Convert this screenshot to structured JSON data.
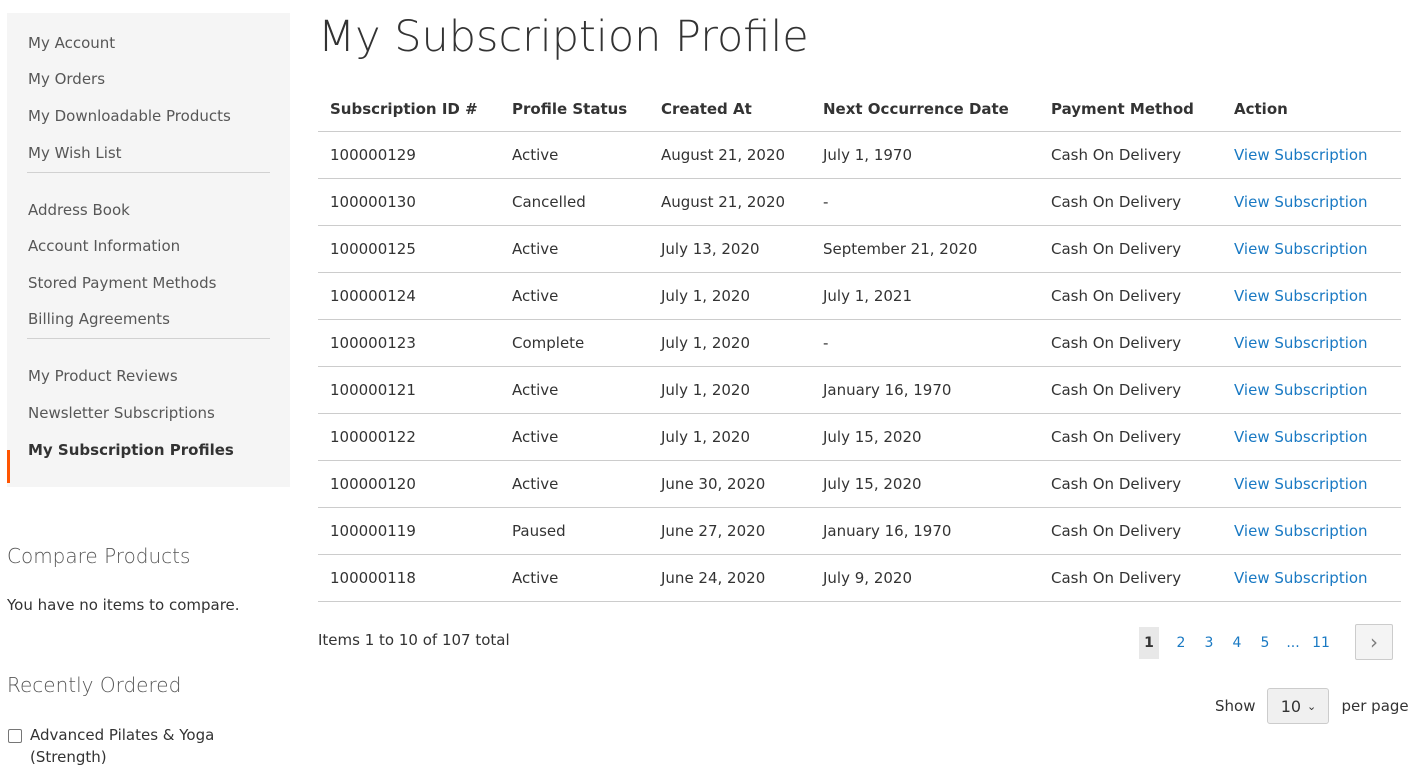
{
  "sidebar": {
    "groups": [
      [
        "My Account",
        "My Orders",
        "My Downloadable Products",
        "My Wish List"
      ],
      [
        "Address Book",
        "Account Information",
        "Stored Payment Methods",
        "Billing Agreements"
      ],
      [
        "My Product Reviews",
        "Newsletter Subscriptions",
        "My Subscription Profiles"
      ]
    ],
    "current": "My Subscription Profiles",
    "accent": "#ff5501"
  },
  "compare": {
    "title": "Compare Products",
    "empty": "You have no items to compare."
  },
  "recent": {
    "title": "Recently Ordered",
    "items": [
      "Advanced Pilates & Yoga (Strength)"
    ]
  },
  "page_title": "My Subscription Profile",
  "table": {
    "headers": [
      "Subscription ID #",
      "Profile Status",
      "Created At",
      "Next Occurrence Date",
      "Payment Method",
      "Action"
    ],
    "rows": [
      [
        "100000129",
        "Active",
        "August 21, 2020",
        "July 1, 1970",
        "Cash On Delivery",
        "View Subscription"
      ],
      [
        "100000130",
        "Cancelled",
        "August 21, 2020",
        "-",
        "Cash On Delivery",
        "View Subscription"
      ],
      [
        "100000125",
        "Active",
        "July 13, 2020",
        "September 21, 2020",
        "Cash On Delivery",
        "View Subscription"
      ],
      [
        "100000124",
        "Active",
        "July 1, 2020",
        "July 1, 2021",
        "Cash On Delivery",
        "View Subscription"
      ],
      [
        "100000123",
        "Complete",
        "July 1, 2020",
        "-",
        "Cash On Delivery",
        "View Subscription"
      ],
      [
        "100000121",
        "Active",
        "July 1, 2020",
        "January 16, 1970",
        "Cash On Delivery",
        "View Subscription"
      ],
      [
        "100000122",
        "Active",
        "July 1, 2020",
        "July 15, 2020",
        "Cash On Delivery",
        "View Subscription"
      ],
      [
        "100000120",
        "Active",
        "June 30, 2020",
        "July 15, 2020",
        "Cash On Delivery",
        "View Subscription"
      ],
      [
        "100000119",
        "Paused",
        "June 27, 2020",
        "January 16, 1970",
        "Cash On Delivery",
        "View Subscription"
      ],
      [
        "100000118",
        "Active",
        "June 24, 2020",
        "July 9, 2020",
        "Cash On Delivery",
        "View Subscription"
      ]
    ]
  },
  "toolbar": {
    "amount": "Items 1 to 10 of 107 total",
    "pages": [
      "1",
      "2",
      "3",
      "4",
      "5",
      "...",
      "11"
    ],
    "current_page": "1",
    "show": "Show",
    "limit": "10",
    "per_page": "per page"
  }
}
